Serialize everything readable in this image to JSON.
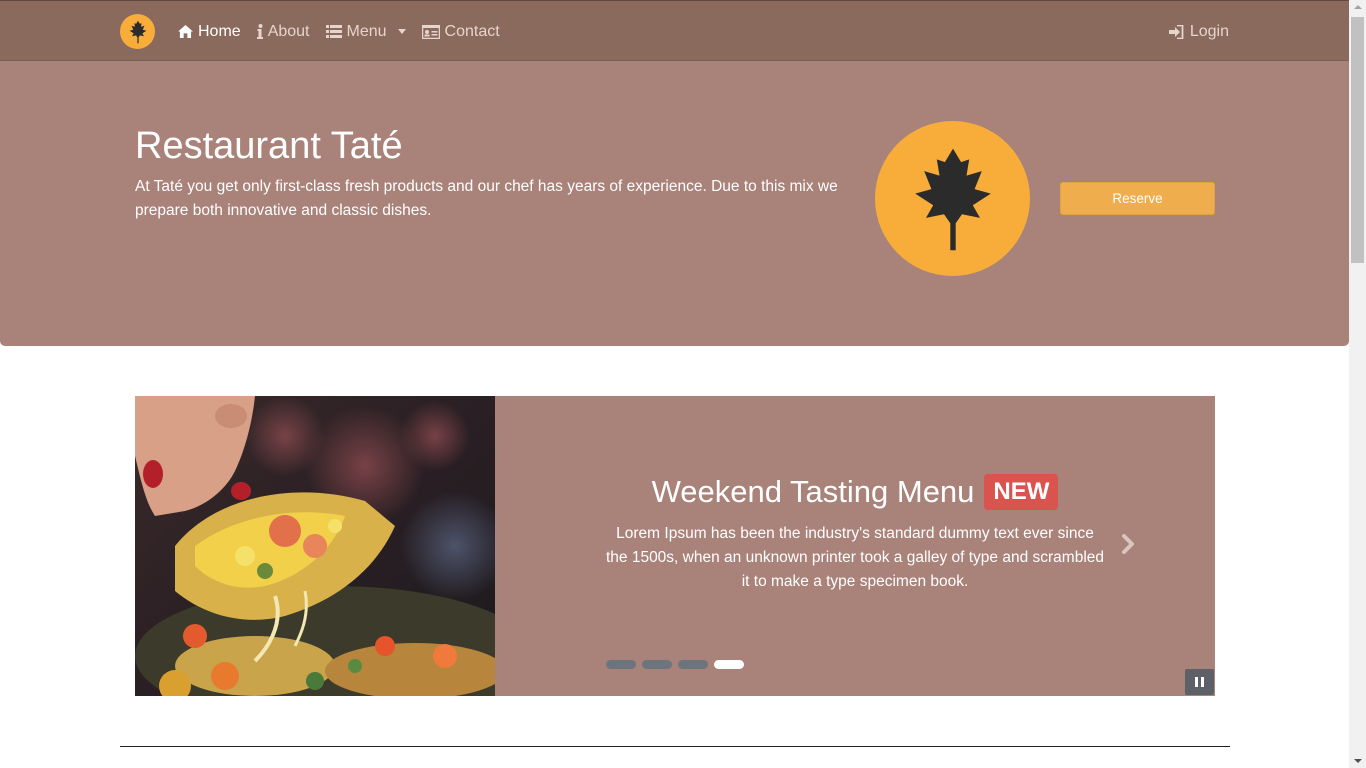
{
  "navbar": {
    "brand_icon": "leaf-icon",
    "items": [
      {
        "label": "Home",
        "icon": "home-icon",
        "active": true
      },
      {
        "label": "About",
        "icon": "info-icon",
        "active": false
      },
      {
        "label": "Menu",
        "icon": "list-icon",
        "active": false,
        "dropdown": true
      },
      {
        "label": "Contact",
        "icon": "contact-card-icon",
        "active": false
      }
    ],
    "login_label": "Login",
    "login_icon": "login-icon"
  },
  "hero": {
    "title": "Restaurant Taté",
    "text": "At Taté you get only first-class fresh products and our chef has years of experience. Due to this mix we prepare both innovative and classic dishes.",
    "reserve_label": "Reserve"
  },
  "carousel": {
    "slide_title": "Weekend Tasting Menu",
    "badge": "NEW",
    "slide_text": "Lorem Ipsum has been the industry's standard dummy text ever since the 1500s, when an unknown printer took a galley of type and scrambled it to make a type specimen book.",
    "indicators": 4,
    "active_indicator": 4
  },
  "colors": {
    "navbar": "#8a6a5c",
    "hero": "#a9827a",
    "accent": "#f8ad3b",
    "button": "#f0ad4e",
    "badge": "#d9534f"
  }
}
